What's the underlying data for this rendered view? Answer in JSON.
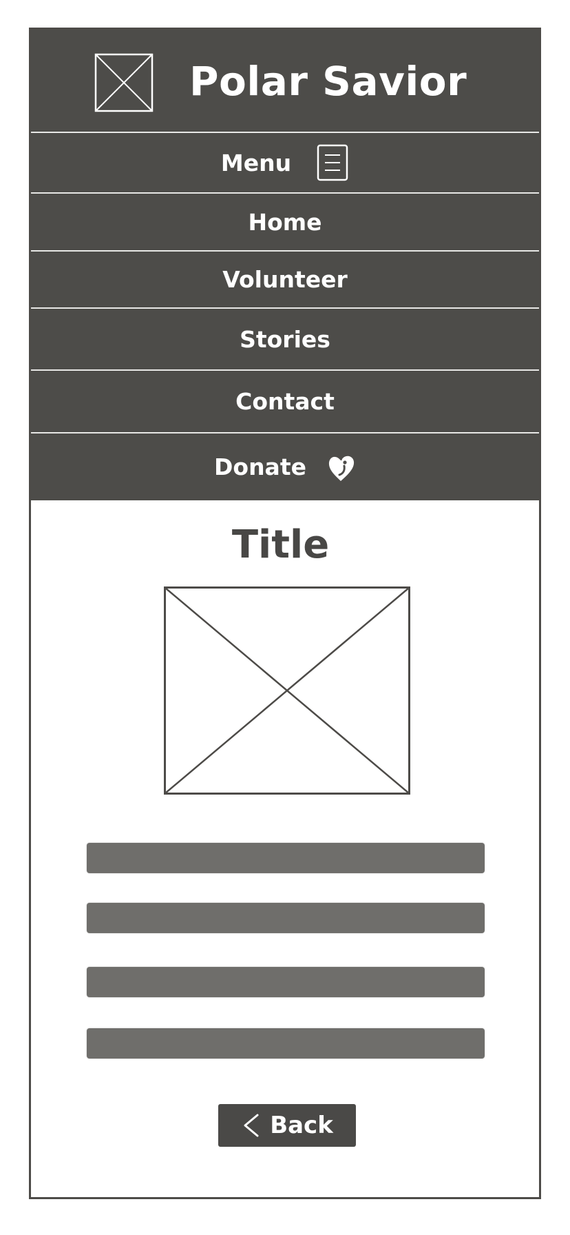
{
  "brand": {
    "title": "Polar Savior"
  },
  "nav": {
    "items": [
      {
        "label": "Menu"
      },
      {
        "label": "Home"
      },
      {
        "label": "Volunteer"
      },
      {
        "label": "Stories"
      },
      {
        "label": "Contact"
      },
      {
        "label": "Donate"
      }
    ]
  },
  "content": {
    "title": "Title",
    "back_label": "Back"
  },
  "icons": {
    "logo": "image-placeholder-icon",
    "menu": "menu-icon",
    "donate": "heart-icon",
    "hero": "image-placeholder-icon",
    "back": "chevron-left-icon"
  },
  "colors": {
    "nav_bg": "#4d4c49",
    "text_bar": "#6f6e6b",
    "button_bg": "#4a4947",
    "border": "#4d4b48"
  }
}
